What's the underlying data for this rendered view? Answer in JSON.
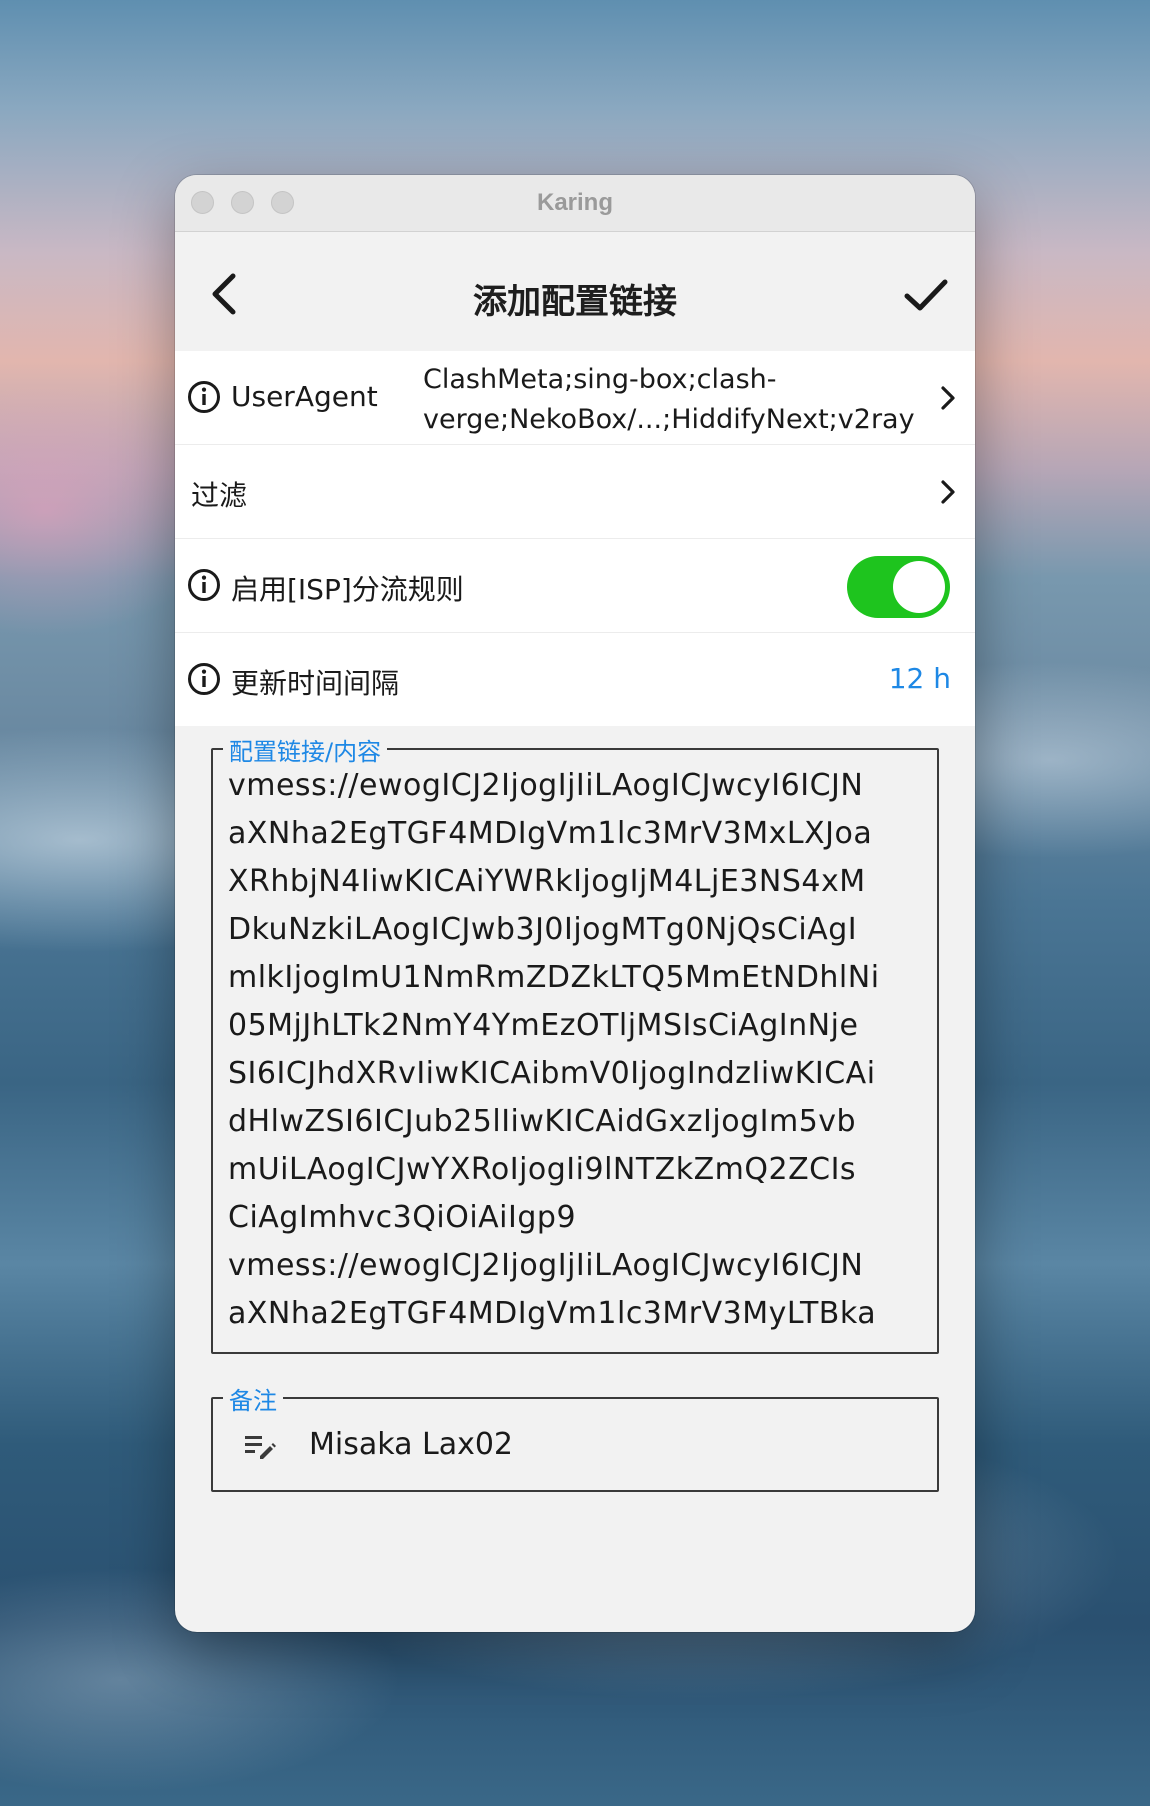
{
  "window": {
    "title": "Karing"
  },
  "appbar": {
    "title": "添加配置链接"
  },
  "rows": {
    "user_agent": {
      "label": "UserAgent",
      "value_line1": "ClashMeta;sing-box;clash-",
      "value_line2": "verge;NekoBox/...;HiddifyNext;v2ray"
    },
    "filter": {
      "label": "过滤"
    },
    "isp_rules": {
      "label": "启用[ISP]分流规则",
      "enabled": true
    },
    "update_interval": {
      "label": "更新时间间隔",
      "value": "12 h"
    }
  },
  "config_field": {
    "legend": "配置链接/内容",
    "lines": [
      "vmess://ewogICJ2IjogIjIiLAogICJwcyI6ICJN",
      "aXNha2EgTGF4MDIgVm1lc3MrV3MxLXJoa",
      "XRhbjN4IiwKICAiYWRkIjogIjM4LjE3NS4xM",
      "DkuNzkiLAogICJwb3J0IjogMTg0NjQsCiAgI",
      "mlkIjogImU1NmRmZDZkLTQ5MmEtNDhlNi",
      "05MjJhLTk2NmY4YmEzOTljMSIsCiAgInNje",
      "SI6ICJhdXRvIiwKICAibmV0IjogIndzIiwKICAi",
      "dHlwZSI6ICJub25lIiwKICAidGxzIjogIm5vb",
      "mUiLAogICJwYXRoIjogIi9lNTZkZmQ2ZCIs",
      "CiAgImhvc3QiOiAiIgp9",
      "vmess://ewogICJ2IjogIjIiLAogICJwcyI6ICJN",
      "aXNha2EgTGF4MDIgVm1lc3MrV3MyLTBka"
    ]
  },
  "note_field": {
    "legend": "备注",
    "value": "Misaka Lax02",
    "icon": "edit-note-icon"
  },
  "colors": {
    "accent": "#1e88e5",
    "toggle_on": "#1ec41e"
  }
}
